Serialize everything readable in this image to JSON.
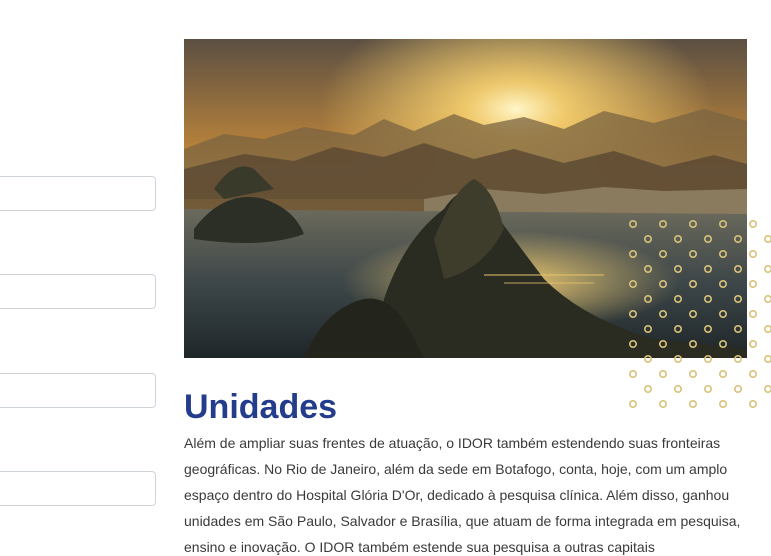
{
  "form": {
    "fields": [
      {
        "value": "",
        "placeholder": ""
      },
      {
        "value": "",
        "placeholder": ""
      },
      {
        "value": "",
        "placeholder": ""
      },
      {
        "value": "",
        "placeholder": ""
      }
    ]
  },
  "hero": {
    "image_subject": "Aerial sunset view of Sugarloaf Mountain and Botafogo bay, Rio de Janeiro"
  },
  "colors": {
    "title": "#233c8c",
    "body_text": "#3a3a3a",
    "dot_accent": "#d8c27a",
    "input_border": "#cfd3da"
  },
  "section": {
    "title": "Unidades",
    "body": "Além de ampliar suas frentes de atuação, o IDOR também estendendo suas fronteiras geográficas. No Rio de Janeiro, além da sede em Botafogo, conta, hoje, com um amplo espaço dentro do Hospital Glória D'Or, dedicado à pesquisa clínica. Além disso, ganhou unidades em São Paulo, Salvador e Brasília, que atuam de forma integrada em pesquisa, ensino e inovação. O IDOR também estende sua pesquisa a outras capitais"
  }
}
